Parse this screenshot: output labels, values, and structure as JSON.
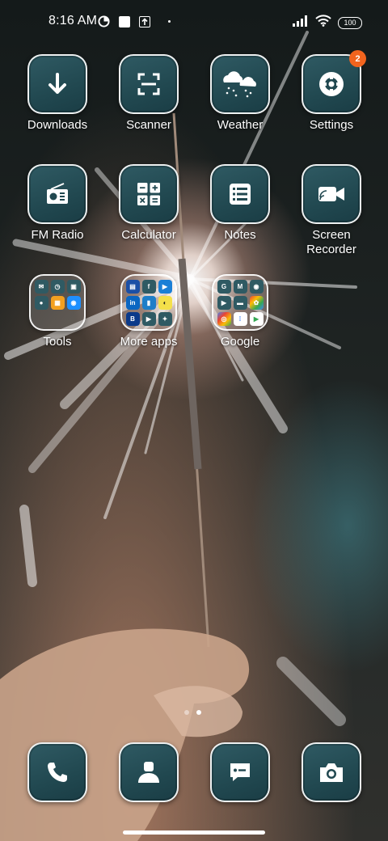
{
  "status_bar": {
    "time": "8:16 AM",
    "battery": "100",
    "icons": [
      "data-saver-icon",
      "notification-square-icon",
      "upload-box-icon",
      "signal-icon",
      "wifi-icon",
      "battery-icon"
    ]
  },
  "apps": {
    "downloads": {
      "label": "Downloads",
      "icon": "download-arrow-icon"
    },
    "scanner": {
      "label": "Scanner",
      "icon": "scan-frame-icon"
    },
    "weather": {
      "label": "Weather",
      "icon": "cloud-rain-icon"
    },
    "settings": {
      "label": "Settings",
      "icon": "gear-icon",
      "badge": "2"
    },
    "fm_radio": {
      "label": "FM Radio",
      "icon": "radio-icon"
    },
    "calculator": {
      "label": "Calculator",
      "icon": "calculator-icon"
    },
    "notes": {
      "label": "Notes",
      "icon": "notes-list-icon"
    },
    "screen_recorder": {
      "label": "Screen\nRecorder",
      "icon": "video-camera-icon"
    }
  },
  "folders": {
    "tools": {
      "label": "Tools"
    },
    "more_apps": {
      "label": "More apps"
    },
    "google": {
      "label": "Google"
    }
  },
  "dock": {
    "phone": {
      "icon": "phone-icon"
    },
    "contacts": {
      "icon": "contact-icon"
    },
    "messages": {
      "icon": "message-icon"
    },
    "camera": {
      "icon": "camera-icon"
    }
  },
  "pages": {
    "count": 2,
    "current": 2
  },
  "colors": {
    "accent_badge": "#f2641e",
    "tile": "#214850"
  }
}
